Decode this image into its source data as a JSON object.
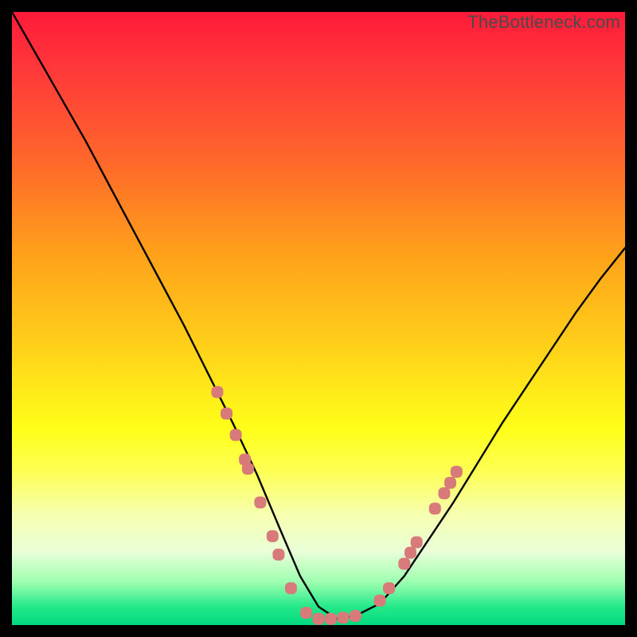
{
  "watermark": "TheBottleneck.com",
  "colors": {
    "frame": "#000000",
    "curve": "#000000",
    "marker_fill": "#d87a7a",
    "marker_stroke": "#c96a6a"
  },
  "chart_data": {
    "type": "line",
    "title": "",
    "xlabel": "",
    "ylabel": "",
    "xlim": [
      0,
      100
    ],
    "ylim": [
      0,
      100
    ],
    "grid": false,
    "legend": false,
    "series": [
      {
        "name": "bottleneck-curve",
        "x": [
          0,
          4,
          8,
          12,
          16,
          20,
          24,
          28,
          32,
          36,
          40,
          44,
          47,
          50,
          53,
          56,
          60,
          64,
          68,
          72,
          76,
          80,
          84,
          88,
          92,
          96,
          100
        ],
        "y": [
          100,
          93,
          86,
          79,
          71.5,
          64,
          56.5,
          49,
          41,
          33,
          24.5,
          15,
          8,
          3,
          1,
          1.5,
          3.5,
          8,
          14,
          20,
          26.5,
          33,
          39,
          45,
          51,
          56.5,
          61.5
        ]
      }
    ],
    "markers": {
      "name": "data-points",
      "shape": "rounded-square",
      "points": [
        {
          "x": 33.5,
          "y": 38.0
        },
        {
          "x": 35.0,
          "y": 34.5
        },
        {
          "x": 36.5,
          "y": 31.0
        },
        {
          "x": 38.0,
          "y": 27.0
        },
        {
          "x": 38.5,
          "y": 25.5
        },
        {
          "x": 40.5,
          "y": 20.0
        },
        {
          "x": 42.5,
          "y": 14.5
        },
        {
          "x": 43.5,
          "y": 11.5
        },
        {
          "x": 45.5,
          "y": 6.0
        },
        {
          "x": 48.0,
          "y": 2.0
        },
        {
          "x": 50.0,
          "y": 1.0
        },
        {
          "x": 52.0,
          "y": 1.0
        },
        {
          "x": 54.0,
          "y": 1.2
        },
        {
          "x": 56.0,
          "y": 1.5
        },
        {
          "x": 60.0,
          "y": 4.0
        },
        {
          "x": 61.5,
          "y": 6.0
        },
        {
          "x": 64.0,
          "y": 10.0
        },
        {
          "x": 65.0,
          "y": 11.8
        },
        {
          "x": 66.0,
          "y": 13.5
        },
        {
          "x": 69.0,
          "y": 19.0
        },
        {
          "x": 70.5,
          "y": 21.5
        },
        {
          "x": 71.5,
          "y": 23.2
        },
        {
          "x": 72.5,
          "y": 25.0
        }
      ]
    }
  }
}
